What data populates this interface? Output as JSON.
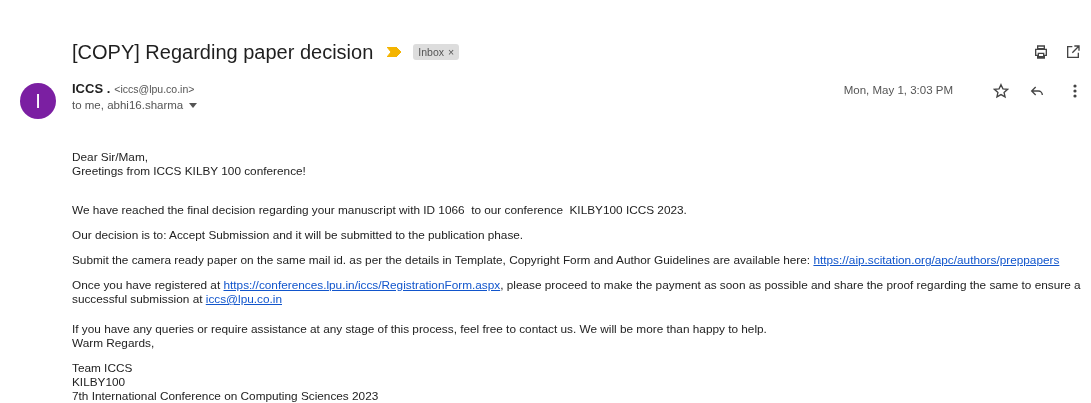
{
  "subject": "[COPY] Regarding paper decision",
  "important": true,
  "label": {
    "text": "Inbox",
    "remove": "×"
  },
  "sender": {
    "initial": "I",
    "name": "ICCS .",
    "email": "<iccs@lpu.co.in>",
    "recipients": "to me, abhi16.sharma"
  },
  "date": "Mon, May 1, 3:03 PM",
  "starred": false,
  "paragraphs": [
    {
      "lines": [
        [
          {
            "kind": "text",
            "text": "Dear Sir/Mam,"
          }
        ],
        [
          {
            "kind": "text",
            "text": "Greetings from ICCS KILBY 100 conference!"
          }
        ]
      ]
    },
    {
      "lines": [
        [
          {
            "kind": "text",
            "text": "We have reached the final decision regarding your manuscript with ID 1066  to our conference  KILBY100 ICCS 2023."
          }
        ]
      ]
    },
    {
      "lines": [
        [
          {
            "kind": "text",
            "text": "Our decision is to: Accept Submission and it will be submitted to the publication phase."
          }
        ]
      ]
    },
    {
      "lines": [
        [
          {
            "kind": "text",
            "text": "Submit the camera ready paper on the same mail id. as per the details in Template, Copyright Form and Author Guidelines are available here: "
          },
          {
            "kind": "link",
            "text": "https://aip.scitation.org/apc/authors/preppapers"
          }
        ]
      ]
    },
    {
      "lines": [
        [
          {
            "kind": "text",
            "text": "Once you have registered at "
          },
          {
            "kind": "link",
            "text": "https://conferences.lpu.in/iccs/RegistrationForm.aspx"
          },
          {
            "kind": "text",
            "text": ", please proceed to make the payment as soon as possible and share the proof regarding the same to ensure a successful submission at "
          },
          {
            "kind": "link",
            "text": "iccs@lpu.co.in"
          }
        ]
      ]
    },
    {
      "lines": [
        [
          {
            "kind": "text",
            "text": "If you have any queries or require assistance at any stage of this process, feel free to contact us. We will be more than happy to help."
          }
        ],
        [
          {
            "kind": "text",
            "text": "Warm Regards,"
          }
        ]
      ]
    },
    {
      "lines": [
        [
          {
            "kind": "text",
            "text": "Team ICCS"
          }
        ],
        [
          {
            "kind": "text",
            "text": "KILBY100"
          }
        ],
        [
          {
            "kind": "text",
            "text": "7th International Conference on Computing Sciences 2023"
          }
        ]
      ]
    }
  ]
}
